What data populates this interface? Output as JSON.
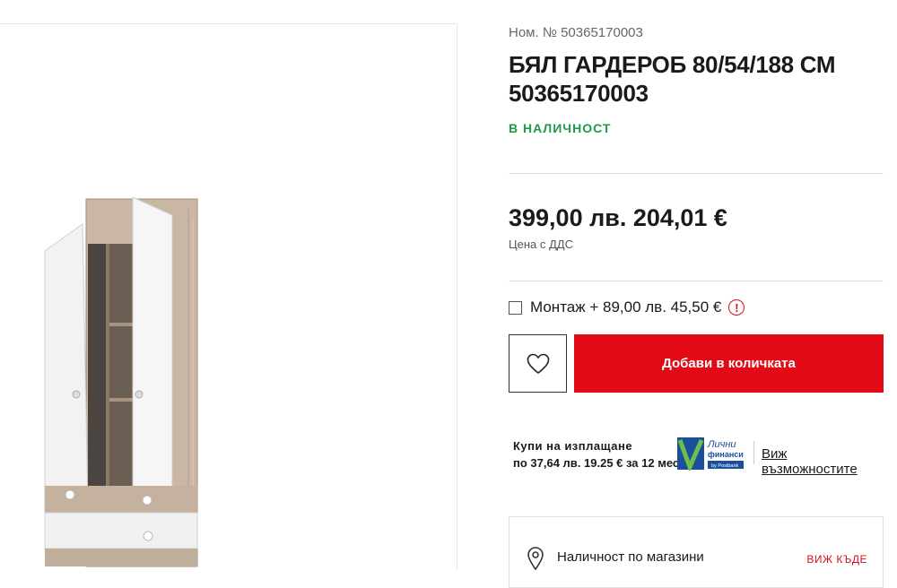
{
  "product": {
    "sku_label": "Ном. № 50365170003",
    "title_line1": "БЯЛ ГАРДЕРОБ 80/54/188 СМ",
    "title_line2": "50365170003",
    "availability": "В НАЛИЧНОСТ",
    "price": "399,00 лв. 204,01 €",
    "vat_note": "Цена с ДДС",
    "image_alt": "Бял гардероб"
  },
  "assembly": {
    "label": "Монтаж + 89,00 лв. 45,50 €",
    "checked": false,
    "info_glyph": "!"
  },
  "actions": {
    "add_to_cart": "Добави в количката",
    "wishlist_icon": "heart-icon"
  },
  "installment": {
    "line1": "Купи на изплащане",
    "line2": "по 37,64 лв. 19.25 € за 12 мес.",
    "partner_line1": "Лични",
    "partner_line2": "финанси",
    "partner_line3": "by Postbank",
    "link": "Виж възможностите"
  },
  "stores": {
    "label": "Наличност по магазини",
    "link": "ВИЖ КЪДЕ"
  },
  "colors": {
    "accent_red": "#e30a17",
    "stock_green": "#1f9a4a",
    "partner_blue": "#1a4f9c",
    "partner_green": "#4caf50"
  }
}
